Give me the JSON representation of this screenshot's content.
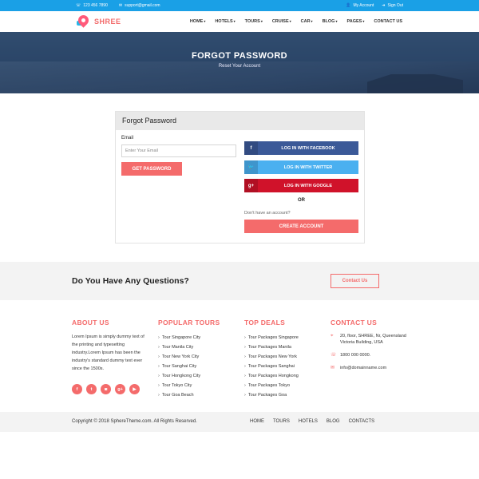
{
  "topbar": {
    "phone": "123 456 7890",
    "email": "support@gmail.com",
    "my_account": "My Account",
    "sign_out": "Sign Out"
  },
  "nav": {
    "logo": "SHREE",
    "items": [
      {
        "label": "HOME",
        "caret": "▾"
      },
      {
        "label": "HOTELS",
        "caret": "▾"
      },
      {
        "label": "TOURS",
        "caret": "▾"
      },
      {
        "label": "CRUISE",
        "caret": "▾"
      },
      {
        "label": "CAR",
        "caret": "▾"
      },
      {
        "label": "BLOG",
        "caret": "▾"
      },
      {
        "label": "PAGES",
        "caret": "▾"
      },
      {
        "label": "CONTACT US",
        "caret": ""
      }
    ]
  },
  "hero": {
    "title": "FORGOT PASSWORD",
    "subtitle": "Reset Your Account"
  },
  "form": {
    "heading": "Forgot Password",
    "email_label": "Email",
    "email_placeholder": "Enter Your Email",
    "get_password": "GET PASSWORD",
    "facebook": "LOG IN WITH FACEBOOK",
    "twitter": "LOG IN WITH TWITTER",
    "google": "LOG IN WITH GOOGLE",
    "or": "OR",
    "no_account": "Don't have an account?",
    "create_account": "CREATE ACCOUNT"
  },
  "questions": {
    "heading": "Do You Have Any Questions?",
    "contact_button": "Contact Us"
  },
  "footer": {
    "about": {
      "title": "ABOUT US",
      "text": "Lorem Ipsum is simply dummy text of the printing and typesetting industry.Lorem Ipsum has been the industry's standard dummy text ever since the 1500s."
    },
    "tours": {
      "title": "POPULAR TOURS",
      "items": [
        "Tour Singapore City",
        "Tour Manila City",
        "Tour New York City",
        "Tour Sanghai City",
        "Tour Hongkong City",
        "Tour Tokyo City",
        "Tour Goa Beach"
      ]
    },
    "deals": {
      "title": "TOP DEALS",
      "items": [
        "Tour Packages Singapore",
        "Tour Packages Manila",
        "Tour Packages New York",
        "Tour Packages Sanghai",
        "Tour Packages Hongkong",
        "Tour Packages Tokyo",
        "Tour Packages Goa"
      ]
    },
    "contact": {
      "title": "CONTACT US",
      "address": "20, floor, SHREE, Nr, Queensland Victoria Building, USA",
      "phone": "1800 000 0000.",
      "email": "info@domainname.com"
    }
  },
  "bottom": {
    "copyright": "Copyright © 2018 SphereTheme.com. All Rights Reserved.",
    "links": [
      "HOME",
      "TOURS",
      "HOTELS",
      "BLOG",
      "CONTACTS"
    ]
  },
  "colors": {
    "topbar": "#1aa0e6",
    "accent": "#f46b6b",
    "facebook": "#3b5998",
    "twitter": "#4ab0f0",
    "google": "#d0122a"
  }
}
